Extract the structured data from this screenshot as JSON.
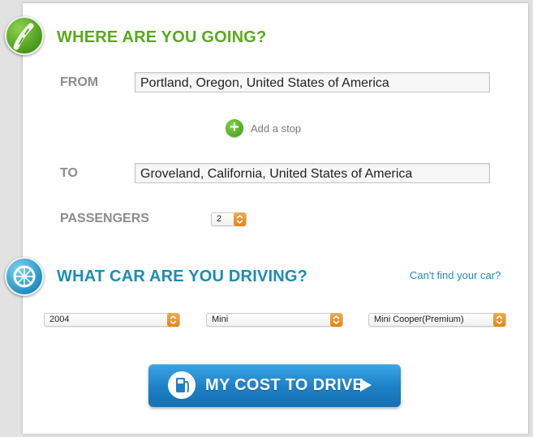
{
  "trip": {
    "title": "WHERE ARE YOU GOING?",
    "from_label": "FROM",
    "from_value": "Portland, Oregon, United States of America",
    "add_stop_label": "Add a stop",
    "to_label": "TO",
    "to_value": "Groveland, California, United States of America",
    "passengers_label": "PASSENGERS",
    "passengers_value": "2"
  },
  "car": {
    "title": "WHAT CAR ARE YOU DRIVING?",
    "help_link": "Can't find your car?",
    "year_value": "2004",
    "make_value": "Mini",
    "model_value": "Mini Cooper(Premium)"
  },
  "cta": {
    "label": "MY COST TO DRIVE"
  },
  "icons": {
    "trip_badge": "road-icon",
    "car_badge": "wheel-icon",
    "add_stop": "plus-icon",
    "cta": "gas-pump-icon",
    "cta_arrow": "play-arrow-icon",
    "select_arrow": "chevron-updown-icon"
  },
  "colors": {
    "green_accent": "#5aa91e",
    "blue_accent": "#1d8cb4",
    "select_arrow": "#e48412",
    "cta_button": "#1d80c6"
  }
}
